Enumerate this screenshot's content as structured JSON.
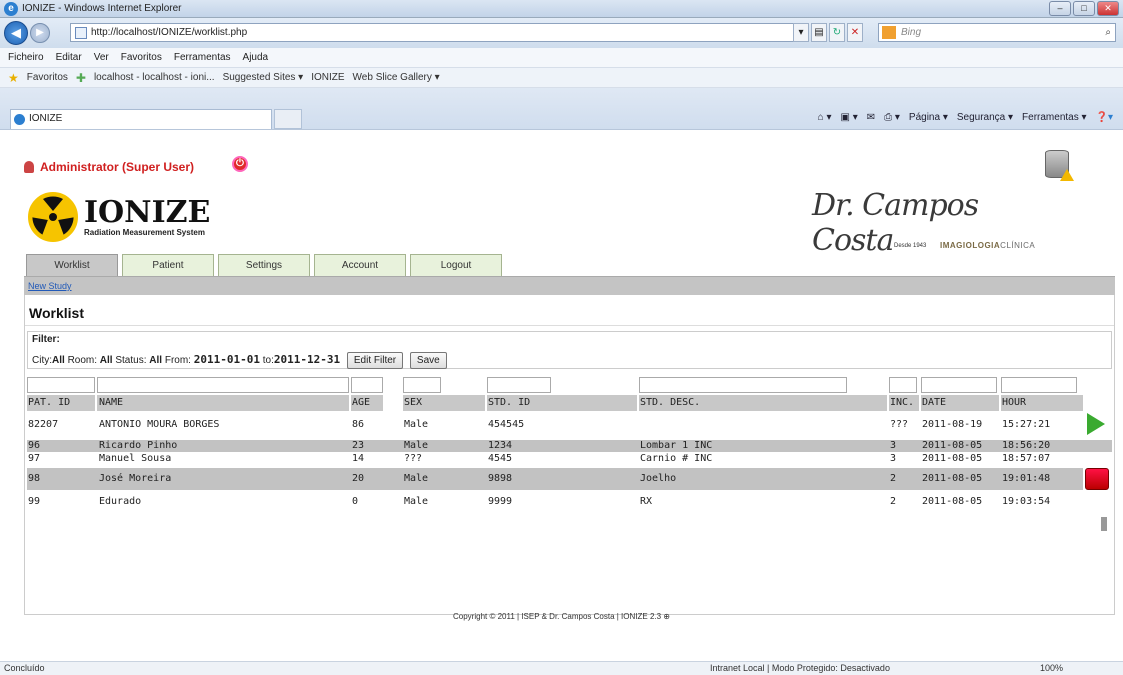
{
  "window": {
    "title": "IONIZE - Windows Internet Explorer"
  },
  "address": {
    "url": "http://localhost/IONIZE/worklist.php",
    "search_placeholder": "Bing"
  },
  "menu": [
    "Ficheiro",
    "Editar",
    "Ver",
    "Favoritos",
    "Ferramentas",
    "Ajuda"
  ],
  "favorites": {
    "label": "Favoritos",
    "items": [
      "localhost - localhost - ioni...",
      "Suggested Sites ▾",
      "IONIZE",
      "Web Slice Gallery ▾"
    ]
  },
  "tab": {
    "title": "IONIZE"
  },
  "commandbar": [
    "Página ▾",
    "Segurança ▾",
    "Ferramentas ▾"
  ],
  "app": {
    "user": "Administrator (Super User)",
    "logo_name": "IONIZE",
    "logo_sub": "Radiation Measurement System",
    "clinic_sig": "Dr. Campos Costa",
    "clinic_desde": "Desde 1943",
    "clinic_imag_bold": "IMAGIOLOGIA",
    "clinic_imag_rest": "CLÍNICA",
    "tabs": [
      "Worklist",
      "Patient",
      "Settings",
      "Account",
      "Logout"
    ],
    "new_study": "New Study",
    "page_title": "Worklist",
    "filter": {
      "label": "Filter:",
      "city_label": "City:",
      "city": "All",
      "room_label": "Room:",
      "room": "All",
      "status_label": "Status:",
      "status": "All",
      "from_label": "From:",
      "from": "2011-01-01",
      "to_label": "to:",
      "to": "2011-12-31",
      "edit_button": "Edit Filter",
      "save_button": "Save"
    },
    "columns": [
      "PAT. ID",
      "NAME",
      "AGE",
      "SEX",
      "STD. ID",
      "STD. DESC.",
      "INC.",
      "DATE",
      "HOUR"
    ],
    "rows": [
      [
        "82207",
        "ANTONIO MOURA BORGES",
        "86",
        "Male",
        "454545",
        "",
        "???",
        "2011-08-19",
        "15:27:21"
      ],
      [
        "96",
        "Ricardo Pinho",
        "23",
        "Male",
        "1234",
        "Lombar 1 INC",
        "3",
        "2011-08-05",
        "18:56:20"
      ],
      [
        "97",
        "Manuel Sousa",
        "14",
        "???",
        "4545",
        "Carnio # INC",
        "3",
        "2011-08-05",
        "18:57:07"
      ],
      [
        "98",
        "José Moreira",
        "20",
        "Male",
        "9898",
        "Joelho",
        "2",
        "2011-08-05",
        "19:01:48"
      ],
      [
        "99",
        "Edurado",
        "0",
        "Male",
        "9999",
        "RX",
        "2",
        "2011-08-05",
        "19:03:54"
      ]
    ],
    "footer": "Copyright © 2011 | ISEP & Dr. Campos Costa | IONIZE 2.3 ⊕"
  },
  "statusbar": {
    "left": "Concluído",
    "middle": "Intranet Local | Modo Protegido: Desactivado",
    "right": "100%"
  }
}
